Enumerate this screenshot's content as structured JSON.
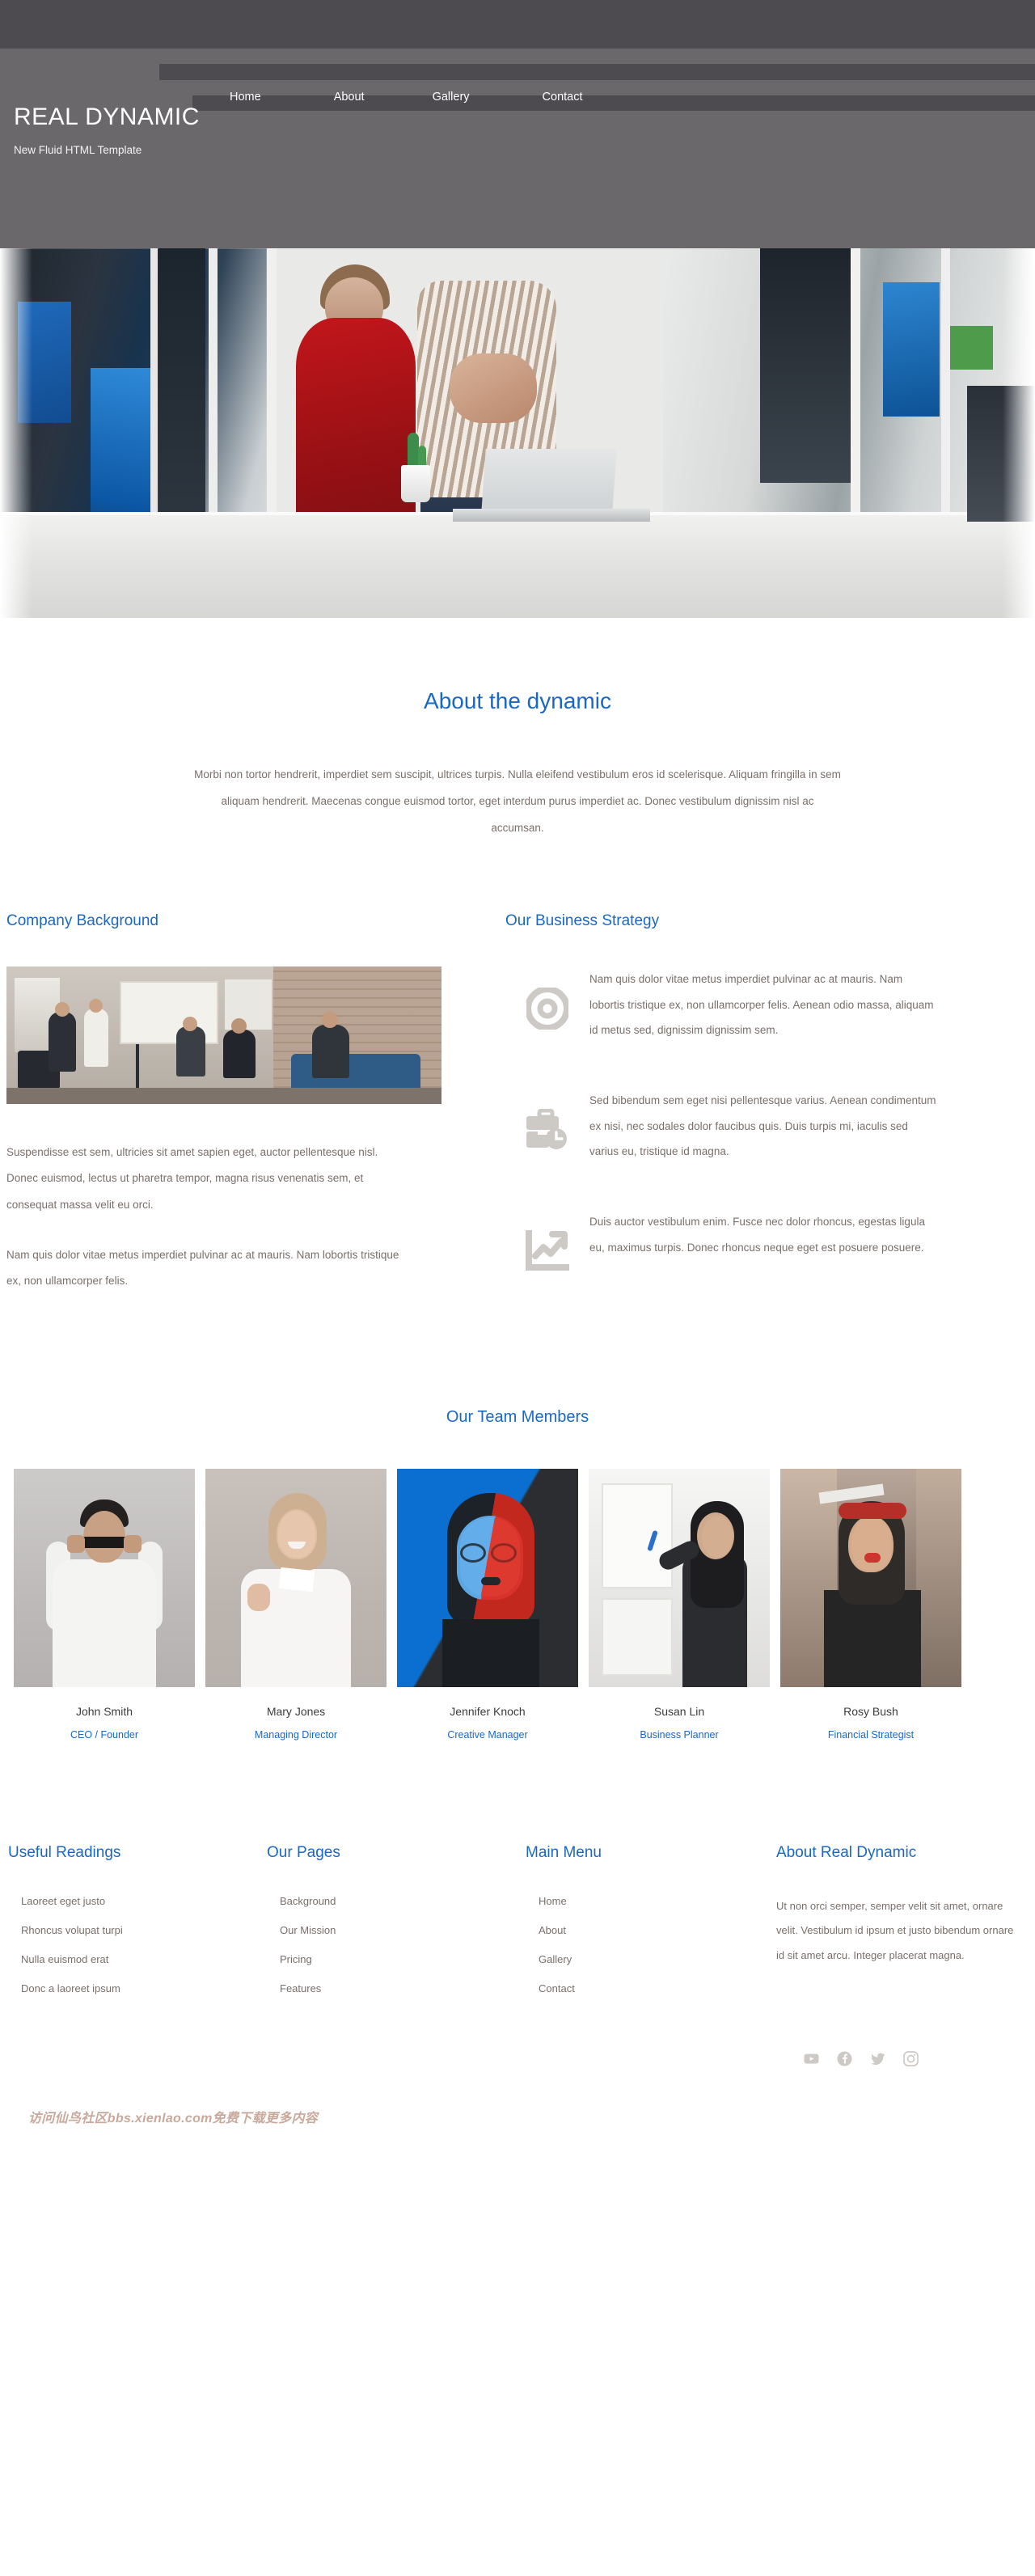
{
  "header": {
    "brand_title": "REAL DYNAMIC",
    "brand_subtitle": "New Fluid HTML Template",
    "nav": [
      {
        "label": "Home",
        "active": false
      },
      {
        "label": "About",
        "active": true
      },
      {
        "label": "Gallery",
        "active": false
      },
      {
        "label": "Contact",
        "active": false
      }
    ]
  },
  "hero": {
    "alt": "Two colleagues working at a laptop in a bright open-plan office"
  },
  "about": {
    "title": "About the dynamic",
    "paragraph": "Morbi non tortor hendrerit, imperdiet sem suscipit, ultrices turpis. Nulla eleifend vestibulum eros id scelerisque. Aliquam fringilla in sem aliquam hendrerit. Maecenas congue euismod tortor, eget interdum purus imperdiet ac. Donec vestibulum dignissim nisl ac accumsan."
  },
  "company_background": {
    "title": "Company Background",
    "image_alt": "Team collaborating in a creative studio with whiteboard",
    "paragraphs": [
      "Suspendisse est sem, ultricies sit amet sapien eget, auctor pellentesque nisl. Donec euismod, lectus ut pharetra tempor, magna risus venenatis sem, et consequat massa velit eu orci.",
      "Nam quis dolor vitae metus imperdiet pulvinar ac at mauris. Nam lobortis tristique ex, non ullamcorper felis."
    ]
  },
  "business_strategy": {
    "title": "Our Business Strategy",
    "items": [
      {
        "icon": "target-icon",
        "text": "Nam quis dolor vitae metus imperdiet pulvinar ac at mauris. Nam lobortis tristique ex, non ullamcorper felis. Aenean odio massa, aliquam id metus sed, dignissim dignissim sem."
      },
      {
        "icon": "briefcase-clock-icon",
        "text": "Sed bibendum sem eget nisi pellentesque varius. Aenean condimentum ex nisi, nec sodales dolor faucibus quis. Duis turpis mi, iaculis sed varius eu, tristique id magna."
      },
      {
        "icon": "growth-chart-icon",
        "text": "Duis auctor vestibulum enim. Fusce nec dolor rhoncus, egestas ligula eu, maximus turpis. Donec rhoncus neque eget est posuere posuere."
      }
    ]
  },
  "team": {
    "title": "Our Team Members",
    "members": [
      {
        "name": "John Smith",
        "role": "CEO / Founder"
      },
      {
        "name": "Mary Jones",
        "role": "Managing Director"
      },
      {
        "name": "Jennifer Knoch",
        "role": "Creative Manager"
      },
      {
        "name": "Susan Lin",
        "role": "Business Planner"
      },
      {
        "name": "Rosy Bush",
        "role": "Financial Strategist"
      }
    ]
  },
  "footer": {
    "columns": [
      {
        "title": "Useful Readings",
        "links": [
          "Laoreet eget justo",
          "Rhoncus volupat turpi",
          "Nulla euismod erat",
          "Donc a laoreet ipsum"
        ]
      },
      {
        "title": "Our Pages",
        "links": [
          "Background",
          "Our Mission",
          "Pricing",
          "Features"
        ]
      },
      {
        "title": "Main Menu",
        "links": [
          "Home",
          "About",
          "Gallery",
          "Contact"
        ]
      }
    ],
    "about_column": {
      "title": "About Real Dynamic",
      "text": "Ut non orci semper, semper velit sit amet, ornare velit. Vestibulum id ipsum et justo bibendum ornare id sit amet arcu. Integer placerat magna."
    },
    "social": [
      {
        "name": "youtube-icon"
      },
      {
        "name": "facebook-icon"
      },
      {
        "name": "twitter-icon"
      },
      {
        "name": "instagram-icon"
      }
    ],
    "watermark": "访问仙鸟社区bbs.xienlao.com免费下载更多内容"
  },
  "colors": {
    "accent_blue": "#1968c4",
    "header_gray": "#6b686b",
    "header_stripe": "#4d4b4f",
    "nav_active": "#403e42",
    "body_text": "#7a6f6a",
    "icon_gray": "#cdcac6",
    "watermark": "#c9a99b"
  }
}
